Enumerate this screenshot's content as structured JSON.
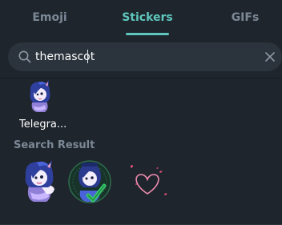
{
  "tabs": {
    "emoji": "Emoji",
    "stickers": "Stickers",
    "gifs": "GIFs",
    "active": "Stickers"
  },
  "search": {
    "value": "themascot"
  },
  "sticker_set": {
    "title": "Telegra..."
  },
  "results": {
    "heading": "Search Result",
    "items": [
      {
        "icon": "mascot-girl-sticker"
      },
      {
        "icon": "mascot-checkmark-sticker"
      },
      {
        "icon": "heart-outline-sticker"
      }
    ]
  },
  "colors": {
    "background": "#1f252c",
    "accent": "#5ec7bd",
    "muted_text": "#7b8896",
    "search_bg": "#2b343c",
    "text": "#ffffff"
  }
}
